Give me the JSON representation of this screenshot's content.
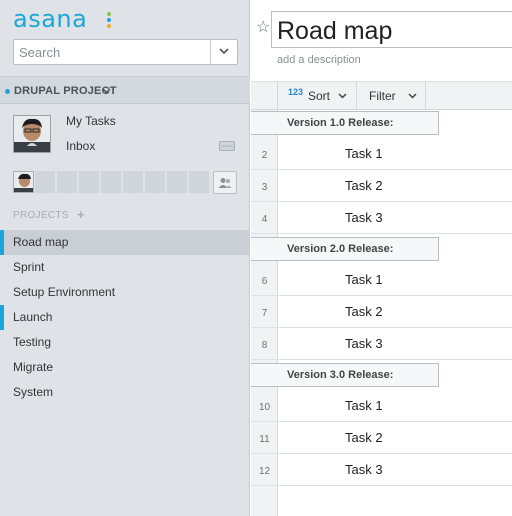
{
  "brand": {
    "name": "asana",
    "dot_colors": [
      "#8bc53f",
      "#1aa6d8",
      "#f5a623"
    ]
  },
  "search": {
    "placeholder": "Search"
  },
  "workspace": {
    "name": "DRUPAL PROJECT"
  },
  "nav": {
    "my_tasks": "My Tasks",
    "inbox": "Inbox"
  },
  "projects": {
    "header": "PROJECTS",
    "add": "+",
    "items": [
      {
        "label": "Road map",
        "selected": true
      },
      {
        "label": "Sprint"
      },
      {
        "label": "Setup Environment"
      },
      {
        "label": "Launch",
        "marked": true
      },
      {
        "label": "Testing"
      },
      {
        "label": "Migrate"
      },
      {
        "label": "System"
      }
    ]
  },
  "main": {
    "title": "Road map",
    "description_placeholder": "add a description",
    "toolbar": {
      "sort_icon": "123",
      "sort_label": "Sort",
      "filter_label": "Filter"
    },
    "sections": [
      {
        "title": "Version 1.0 Release:",
        "tasks": [
          {
            "num": "2",
            "label": "Task 1"
          },
          {
            "num": "3",
            "label": "Task 2"
          },
          {
            "num": "4",
            "label": "Task 3"
          }
        ]
      },
      {
        "title": "Version 2.0 Release:",
        "tasks": [
          {
            "num": "6",
            "label": "Task 1"
          },
          {
            "num": "7",
            "label": "Task 2"
          },
          {
            "num": "8",
            "label": "Task 3"
          }
        ]
      },
      {
        "title": "Version 3.0 Release:",
        "tasks": [
          {
            "num": "10",
            "label": "Task 1"
          },
          {
            "num": "11",
            "label": "Task 2"
          },
          {
            "num": "12",
            "label": "Task 3"
          }
        ]
      }
    ]
  },
  "colors": {
    "accent": "#1aa6d8",
    "sidebar_bg": "#dfe3e8"
  }
}
